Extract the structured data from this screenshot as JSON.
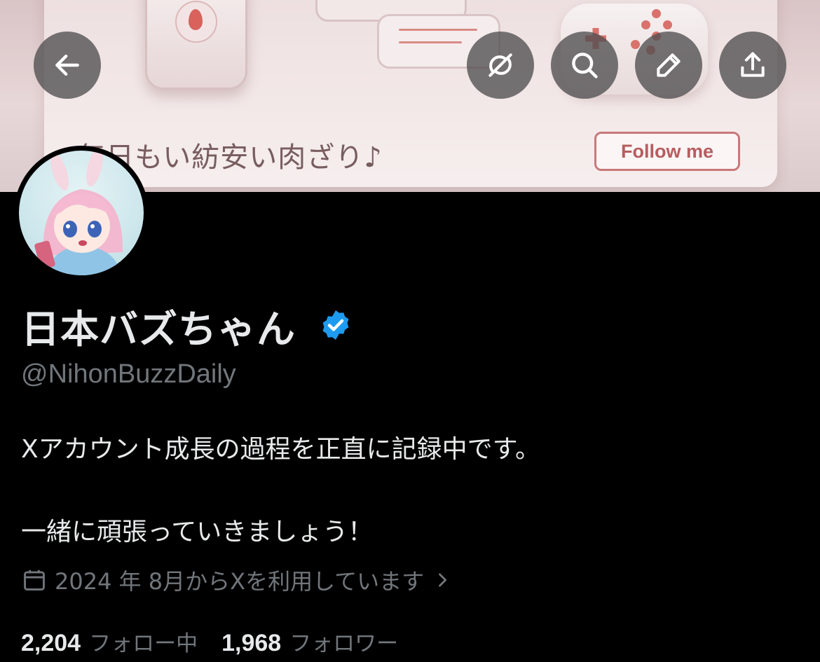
{
  "banner": {
    "tagline": "毎日もい紡安い肉ざり♪",
    "follow_me_label": "Follow me"
  },
  "header_actions": {
    "back": "back-arrow-icon",
    "grok": "grok-icon",
    "search": "search-icon",
    "edit": "pencil-icon",
    "share": "share-icon"
  },
  "profile": {
    "display_name": "日本バズちゃん",
    "handle": "@NihonBuzzDaily",
    "verified": true,
    "bio_line1": "Xアカウント成長の過程を正直に記録中です。",
    "bio_line2": "一緒に頑張っていきましょう！",
    "joined": "2024 年 8月からXを利用しています",
    "following_count": "2,204",
    "following_label": "フォロー中",
    "followers_count": "1,968",
    "followers_label": "フォロワー"
  },
  "colors": {
    "background": "#000000",
    "primary_text": "#e7e9ea",
    "secondary_text": "#71767b",
    "verified_blue": "#1d9bf0",
    "icon_button_bg": "#4f4e50"
  }
}
